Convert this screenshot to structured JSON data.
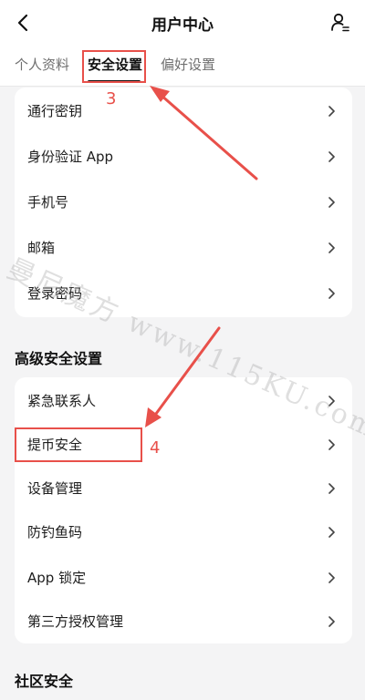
{
  "header": {
    "title": "用户中心",
    "back_icon": "chevron-left-icon",
    "user_settings_icon": "user-settings-icon"
  },
  "tabs": [
    {
      "label": "个人资料"
    },
    {
      "label": "安全设置",
      "active": true
    },
    {
      "label": "偏好设置"
    }
  ],
  "security_items": [
    {
      "label": "通行密钥"
    },
    {
      "label": "身份验证 App"
    },
    {
      "label": "手机号"
    },
    {
      "label": "邮箱"
    },
    {
      "label": "登录密码"
    }
  ],
  "advanced": {
    "title": "高级安全设置",
    "items": [
      {
        "label": "紧急联系人"
      },
      {
        "label": "提币安全"
      },
      {
        "label": "设备管理"
      },
      {
        "label": "防钓鱼码"
      },
      {
        "label": "App 锁定"
      },
      {
        "label": "第三方授权管理"
      }
    ]
  },
  "community": {
    "title": "社区安全"
  },
  "annotations": {
    "step3": "3",
    "step4": "4",
    "color": "#e8504a"
  },
  "watermark": "曼尼魔方 www.115KU.com"
}
